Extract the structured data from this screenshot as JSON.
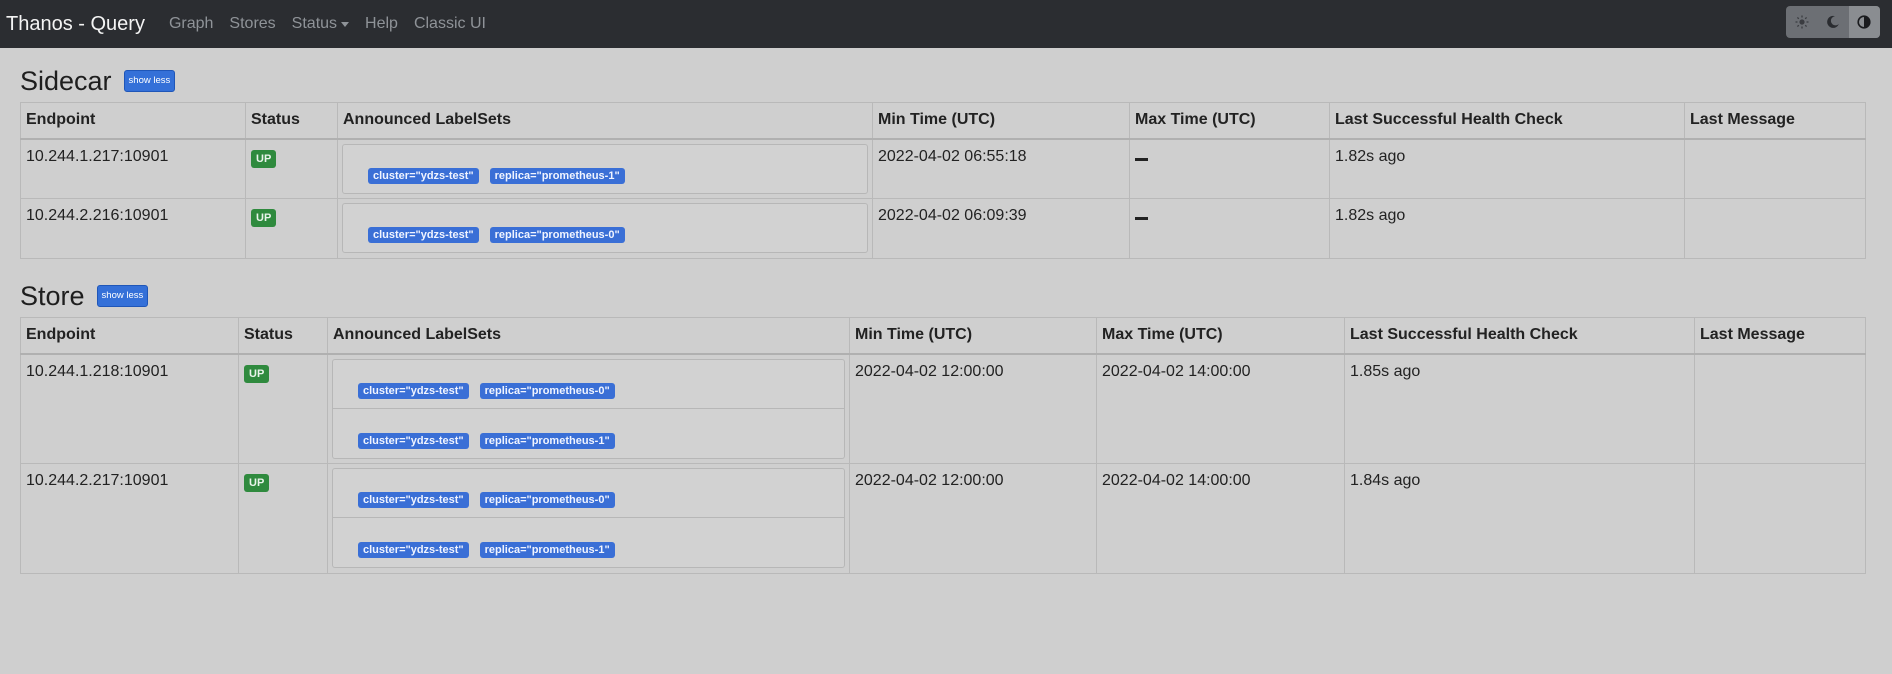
{
  "navbar": {
    "brand": "Thanos - Query",
    "links": [
      "Graph",
      "Stores",
      "Status",
      "Help",
      "Classic UI"
    ],
    "theme_buttons": [
      "sun-icon",
      "moon-icon",
      "contrast-icon"
    ],
    "active_theme": "contrast-icon"
  },
  "sidecar": {
    "title": "Sidecar",
    "toggle_label": "show less",
    "headers": [
      "Endpoint",
      "Status",
      "Announced LabelSets",
      "Min Time (UTC)",
      "Max Time (UTC)",
      "Last Successful Health Check",
      "Last Message"
    ],
    "rows": [
      {
        "endpoint": "10.244.1.217:10901",
        "status": "UP",
        "labelsets": [
          [
            "cluster=\"ydzs-test\"",
            "replica=\"prometheus-1\""
          ]
        ],
        "min_time": "2022-04-02 06:55:18",
        "max_time": "—",
        "health": "1.82s ago",
        "message": ""
      },
      {
        "endpoint": "10.244.2.216:10901",
        "status": "UP",
        "labelsets": [
          [
            "cluster=\"ydzs-test\"",
            "replica=\"prometheus-0\""
          ]
        ],
        "min_time": "2022-04-02 06:09:39",
        "max_time": "—",
        "health": "1.82s ago",
        "message": ""
      }
    ]
  },
  "store": {
    "title": "Store",
    "toggle_label": "show less",
    "headers": [
      "Endpoint",
      "Status",
      "Announced LabelSets",
      "Min Time (UTC)",
      "Max Time (UTC)",
      "Last Successful Health Check",
      "Last Message"
    ],
    "rows": [
      {
        "endpoint": "10.244.1.218:10901",
        "status": "UP",
        "labelsets": [
          [
            "cluster=\"ydzs-test\"",
            "replica=\"prometheus-0\""
          ],
          [
            "cluster=\"ydzs-test\"",
            "replica=\"prometheus-1\""
          ]
        ],
        "min_time": "2022-04-02 12:00:00",
        "max_time": "2022-04-02 14:00:00",
        "health": "1.85s ago",
        "message": ""
      },
      {
        "endpoint": "10.244.2.217:10901",
        "status": "UP",
        "labelsets": [
          [
            "cluster=\"ydzs-test\"",
            "replica=\"prometheus-0\""
          ],
          [
            "cluster=\"ydzs-test\"",
            "replica=\"prometheus-1\""
          ]
        ],
        "min_time": "2022-04-02 12:00:00",
        "max_time": "2022-04-02 14:00:00",
        "health": "1.84s ago",
        "message": ""
      }
    ]
  }
}
